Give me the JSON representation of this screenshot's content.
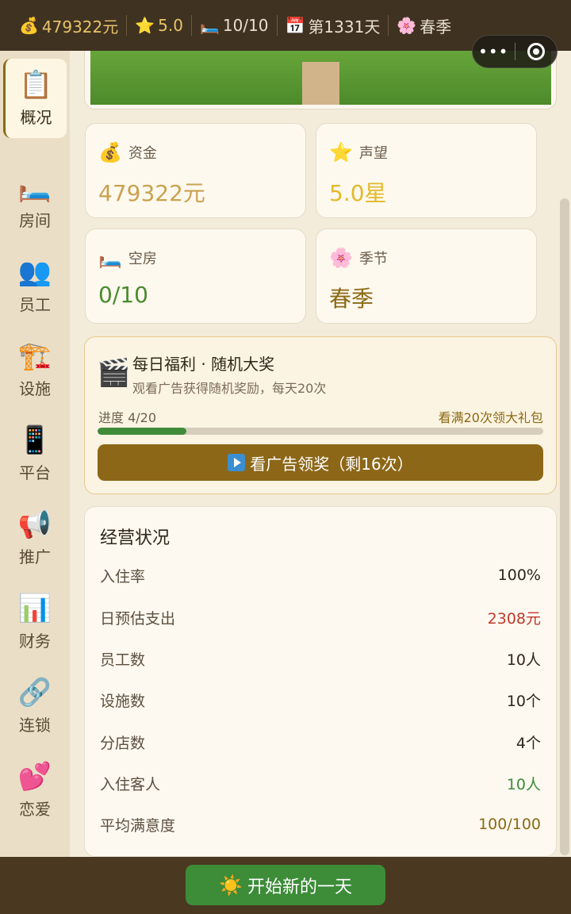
{
  "topbar": {
    "money_icon": "money-bag-icon",
    "money": "479322元",
    "star_icon": "star-icon",
    "rating": "5.0",
    "bed_icon": "bed-icon",
    "rooms": "10/10",
    "calendar_icon": "calendar-icon",
    "day": "第1331天",
    "season_icon": "cherry-blossom-icon",
    "season": "春季"
  },
  "capsule": {
    "more": "•••",
    "close_icon": "target-icon"
  },
  "sidebar": {
    "items": [
      {
        "icon": "clipboard-icon",
        "label": "概况",
        "active": true
      },
      {
        "icon": "bed-icon",
        "label": "房间"
      },
      {
        "icon": "people-icon",
        "label": "员工"
      },
      {
        "icon": "crane-icon",
        "label": "设施"
      },
      {
        "icon": "phone-icon",
        "label": "平台"
      },
      {
        "icon": "megaphone-icon",
        "label": "推广"
      },
      {
        "icon": "chart-icon",
        "label": "财务"
      },
      {
        "icon": "link-icon",
        "label": "连锁"
      },
      {
        "icon": "hearts-icon",
        "label": "恋爱"
      }
    ]
  },
  "stats": {
    "funds": {
      "icon": "money-bag-icon",
      "label": "资金",
      "value": "479322元",
      "color": "#c9a24f"
    },
    "reputation": {
      "icon": "star-icon",
      "label": "声望",
      "value": "5.0星",
      "color": "#e3b92b"
    },
    "vacant": {
      "icon": "bed-icon",
      "label": "空房",
      "value": "0/10",
      "color": "#4b8a2f"
    },
    "season": {
      "icon": "cherry-blossom-icon",
      "label": "季节",
      "value": "春季",
      "color": "#8b6914"
    }
  },
  "ad": {
    "icon": "clapper-icon",
    "title": "每日福利 · 随机大奖",
    "subtitle": "观看广告获得随机奖励，每天20次",
    "progress_label": "进度 4/20",
    "progress_fraction": 0.2,
    "goal": "看满20次领大礼包",
    "button_label": "看广告领奖（剩16次）"
  },
  "operations": {
    "title": "经营状况",
    "rows": [
      {
        "label": "入住率",
        "value": "100%",
        "color": "#2f2619"
      },
      {
        "label": "日预估支出",
        "value": "2308元",
        "color": "#c0392b"
      },
      {
        "label": "员工数",
        "value": "10人",
        "color": "#2f2619"
      },
      {
        "label": "设施数",
        "value": "10个",
        "color": "#2f2619"
      },
      {
        "label": "分店数",
        "value": "4个",
        "color": "#2f2619"
      },
      {
        "label": "入住客人",
        "value": "10人",
        "color": "#3d8b3a"
      },
      {
        "label": "平均满意度",
        "value": "100/100",
        "color": "#8b6914"
      }
    ]
  },
  "footer": {
    "icon": "sun-icon",
    "button_label": "开始新的一天"
  }
}
